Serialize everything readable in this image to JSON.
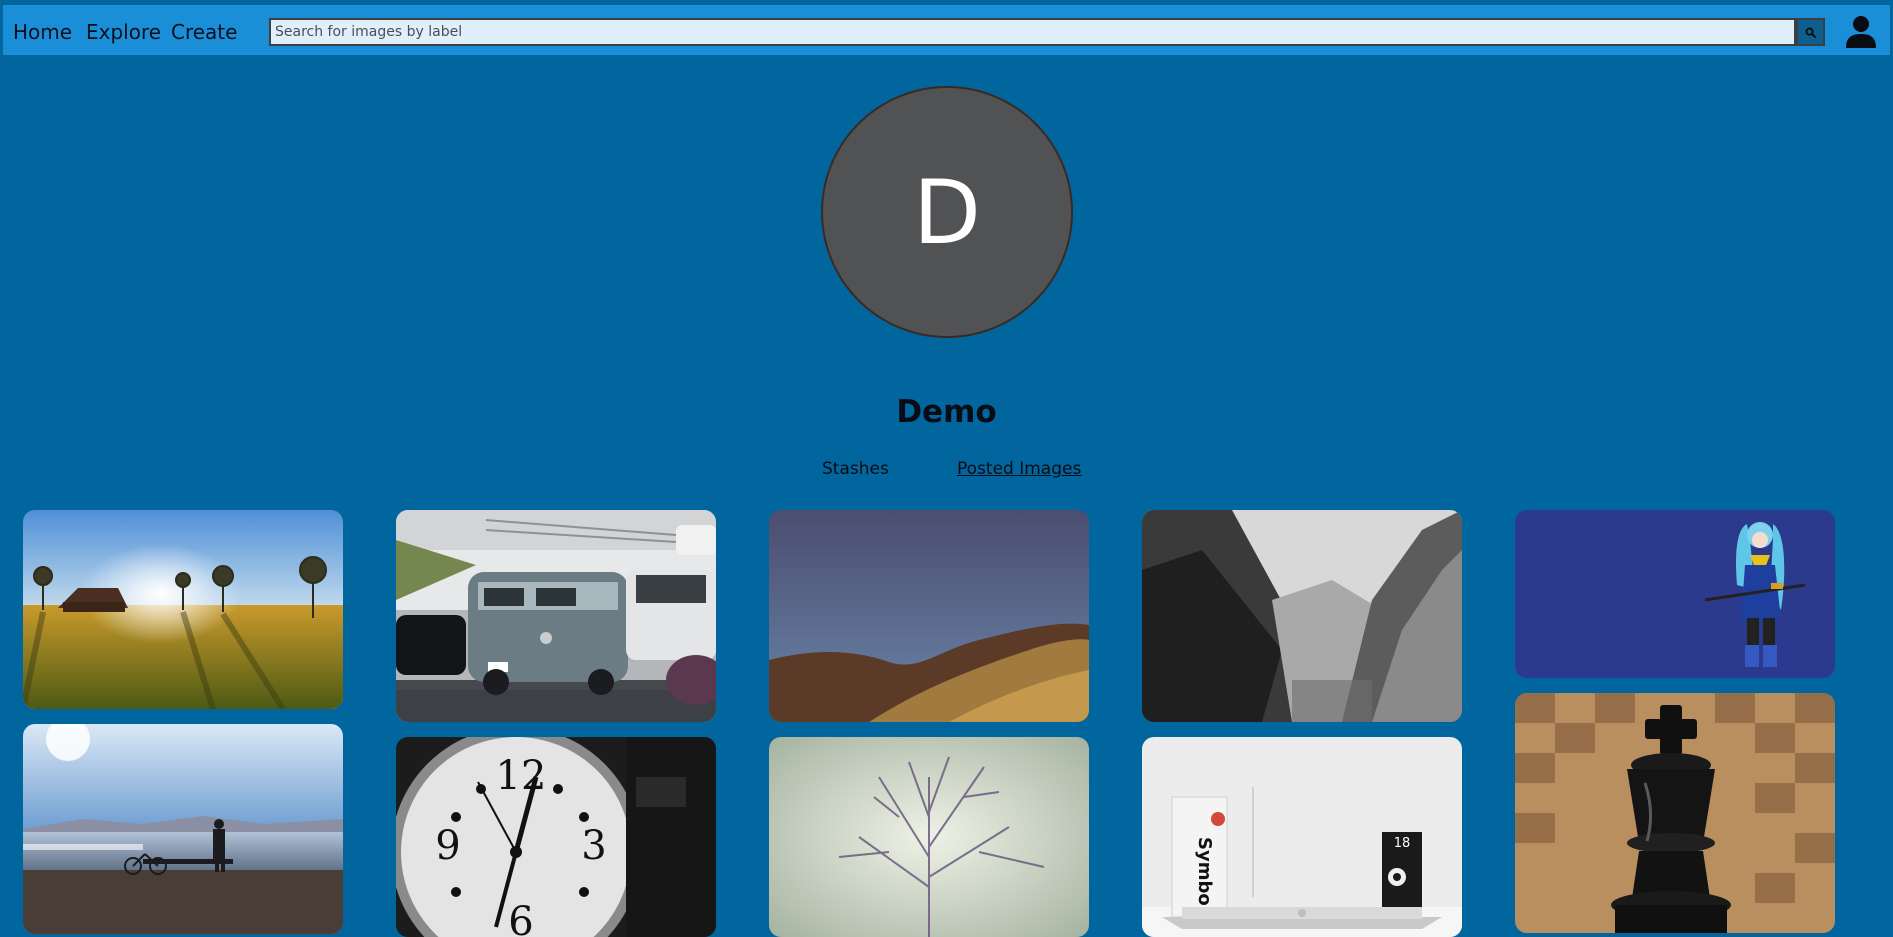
{
  "nav": {
    "home": "Home",
    "explore": "Explore",
    "create": "Create"
  },
  "search": {
    "placeholder": "Search for images by label",
    "button_icon": "search-icon"
  },
  "account_icon": "user-icon",
  "profile": {
    "initial": "D",
    "username": "Demo",
    "avatar_color": "#515254"
  },
  "tabs": {
    "stashes": "Stashes",
    "posted_images": "Posted Images",
    "active": "posted_images"
  },
  "images": [
    {
      "subject": "sunset-field-barn"
    },
    {
      "subject": "vw-van-traffic"
    },
    {
      "subject": "desert-dunes"
    },
    {
      "subject": "misty-valley-bw"
    },
    {
      "subject": "anime-character"
    },
    {
      "subject": "lakeside-man-bicycle"
    },
    {
      "subject": "clock-bw"
    },
    {
      "subject": "bare-tree"
    },
    {
      "subject": "desk-laptop-book"
    },
    {
      "subject": "chess-king"
    }
  ],
  "colors": {
    "background": "#01659e",
    "navbar": "#1a8ed6",
    "search_field": "#dff0fb"
  }
}
